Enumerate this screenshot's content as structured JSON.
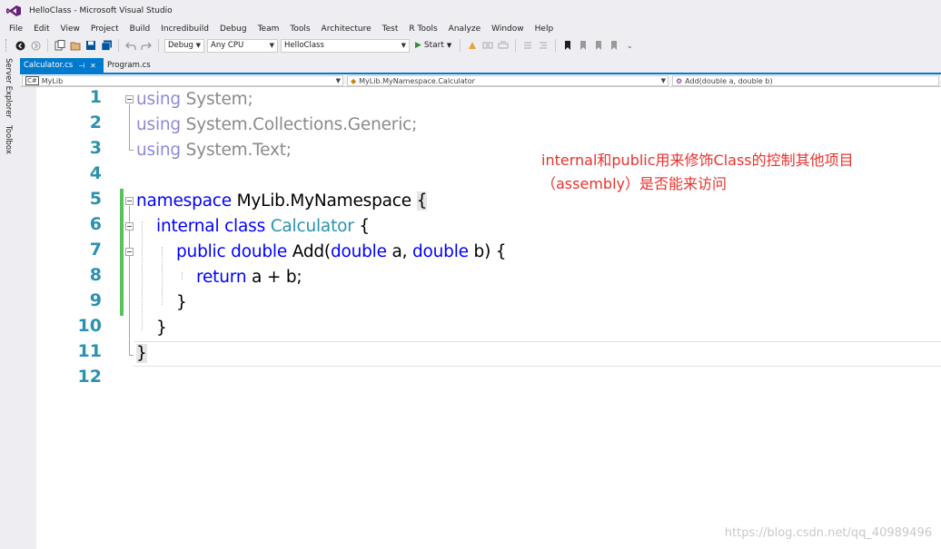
{
  "window": {
    "title": "HelloClass - Microsoft Visual Studio"
  },
  "menu": [
    "File",
    "Edit",
    "View",
    "Project",
    "Build",
    "Incredibuild",
    "Debug",
    "Team",
    "Tools",
    "Architecture",
    "Test",
    "R Tools",
    "Analyze",
    "Window",
    "Help"
  ],
  "toolbar": {
    "config": "Debug",
    "platform": "Any CPU",
    "project": "HelloClass",
    "start_label": "Start"
  },
  "side_tabs": [
    "Server Explorer",
    "Toolbox"
  ],
  "tabs": [
    {
      "label": "Calculator.cs",
      "active": true
    },
    {
      "label": "Program.cs",
      "active": false
    }
  ],
  "navbar": {
    "project": "MyLib",
    "type": "MyLib.MyNamespace.Calculator",
    "member": "Add(double a, double b)"
  },
  "code": {
    "line_numbers": [
      "1",
      "2",
      "3",
      "4",
      "5",
      "6",
      "7",
      "8",
      "9",
      "10",
      "11",
      "12"
    ],
    "l1": {
      "kw": "using",
      "rest": " System;"
    },
    "l2": {
      "kw": "using",
      "rest": " System.Collections.Generic;"
    },
    "l3": {
      "kw": "using",
      "rest": " System.Text;"
    },
    "l5": {
      "kw": "namespace",
      "rest": " MyLib.MyNamespace ",
      "brace": "{"
    },
    "l6": {
      "kw1": "internal",
      "kw2": "class",
      "type": "Calculator",
      "rest": " {"
    },
    "l7": {
      "kw1": "public",
      "kw2": "double",
      "name": " Add(",
      "kw3": "double",
      "mid": " a, ",
      "kw4": "double",
      "end": " b) {"
    },
    "l8": {
      "kw": "return",
      "rest": " a + b;"
    },
    "l9": {
      "text": "}"
    },
    "l10": {
      "text": "}"
    },
    "l11": {
      "text": "}"
    }
  },
  "annotation": {
    "line1": "internal和public用来修饰Class的控制其他项目",
    "line2": "（assembly）是否能来访问"
  },
  "watermark": "https://blog.csdn.net/qq_40989496"
}
